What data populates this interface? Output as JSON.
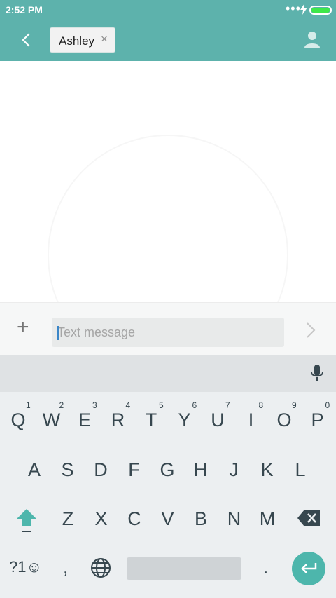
{
  "status": {
    "time": "2:52 PM",
    "signal_dots": "•••"
  },
  "header": {
    "recipient": "Ashley",
    "remove_glyph": "×"
  },
  "compose": {
    "add_glyph": "+",
    "placeholder": "Text message"
  },
  "keyboard": {
    "row1": [
      {
        "k": "Q",
        "h": "1"
      },
      {
        "k": "W",
        "h": "2"
      },
      {
        "k": "E",
        "h": "3"
      },
      {
        "k": "R",
        "h": "4"
      },
      {
        "k": "T",
        "h": "5"
      },
      {
        "k": "Y",
        "h": "6"
      },
      {
        "k": "U",
        "h": "7"
      },
      {
        "k": "I",
        "h": "8"
      },
      {
        "k": "O",
        "h": "9"
      },
      {
        "k": "P",
        "h": "0"
      }
    ],
    "row2": [
      "A",
      "S",
      "D",
      "F",
      "G",
      "H",
      "J",
      "K",
      "L"
    ],
    "row3": [
      "Z",
      "X",
      "C",
      "V",
      "B",
      "N",
      "M"
    ],
    "symbols_label": "?1☺",
    "comma": ",",
    "period": "."
  },
  "colors": {
    "app_bar": "#5db2ac",
    "enter_key": "#4db6ac",
    "shift_key": "#4db6ac",
    "battery": "#3ee84a"
  }
}
